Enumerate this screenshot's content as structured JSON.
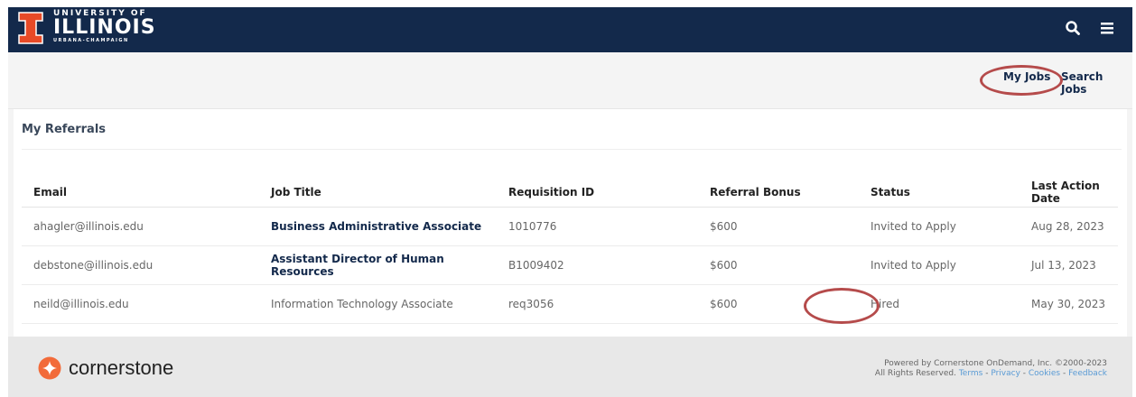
{
  "header": {
    "logo": {
      "line1": "UNIVERSITY OF",
      "line2": "ILLINOIS",
      "line3": "URBANA-CHAMPAIGN"
    },
    "icons": [
      "search-icon",
      "menu-icon"
    ],
    "bg_color": "#13294b",
    "accent_color": "#e84a27"
  },
  "subnav": {
    "my_jobs": "My Jobs",
    "search_jobs": "Search Jobs"
  },
  "page": {
    "title": "My Referrals"
  },
  "table": {
    "headers": [
      "Email",
      "Job Title",
      "Requisition ID",
      "Referral Bonus",
      "Status",
      "Last Action Date"
    ],
    "rows": [
      {
        "email": "ahagler@illinois.edu",
        "job_title": "Business Administrative Associate",
        "req_id": "1010776",
        "bonus": "$600",
        "status": "Invited to Apply",
        "date": "Aug 28, 2023"
      },
      {
        "email": "debstone@illinois.edu",
        "job_title": "Assistant Director of Human Resources",
        "req_id": "B1009402",
        "bonus": "$600",
        "status": "Invited to Apply",
        "date": "Jul 13, 2023"
      },
      {
        "email": "neild@illinois.edu",
        "job_title": "Information Technology Associate",
        "req_id": "req3056",
        "bonus": "$600",
        "status": "Hired",
        "date": "May 30, 2023"
      }
    ]
  },
  "footer": {
    "brand": "cornerstone",
    "powered_by": "Powered by Cornerstone OnDemand, Inc. ©2000-2023",
    "rights": "All Rights Reserved.",
    "links": [
      "Terms",
      "Privacy",
      "Cookies",
      "Feedback"
    ],
    "separator": " - "
  }
}
